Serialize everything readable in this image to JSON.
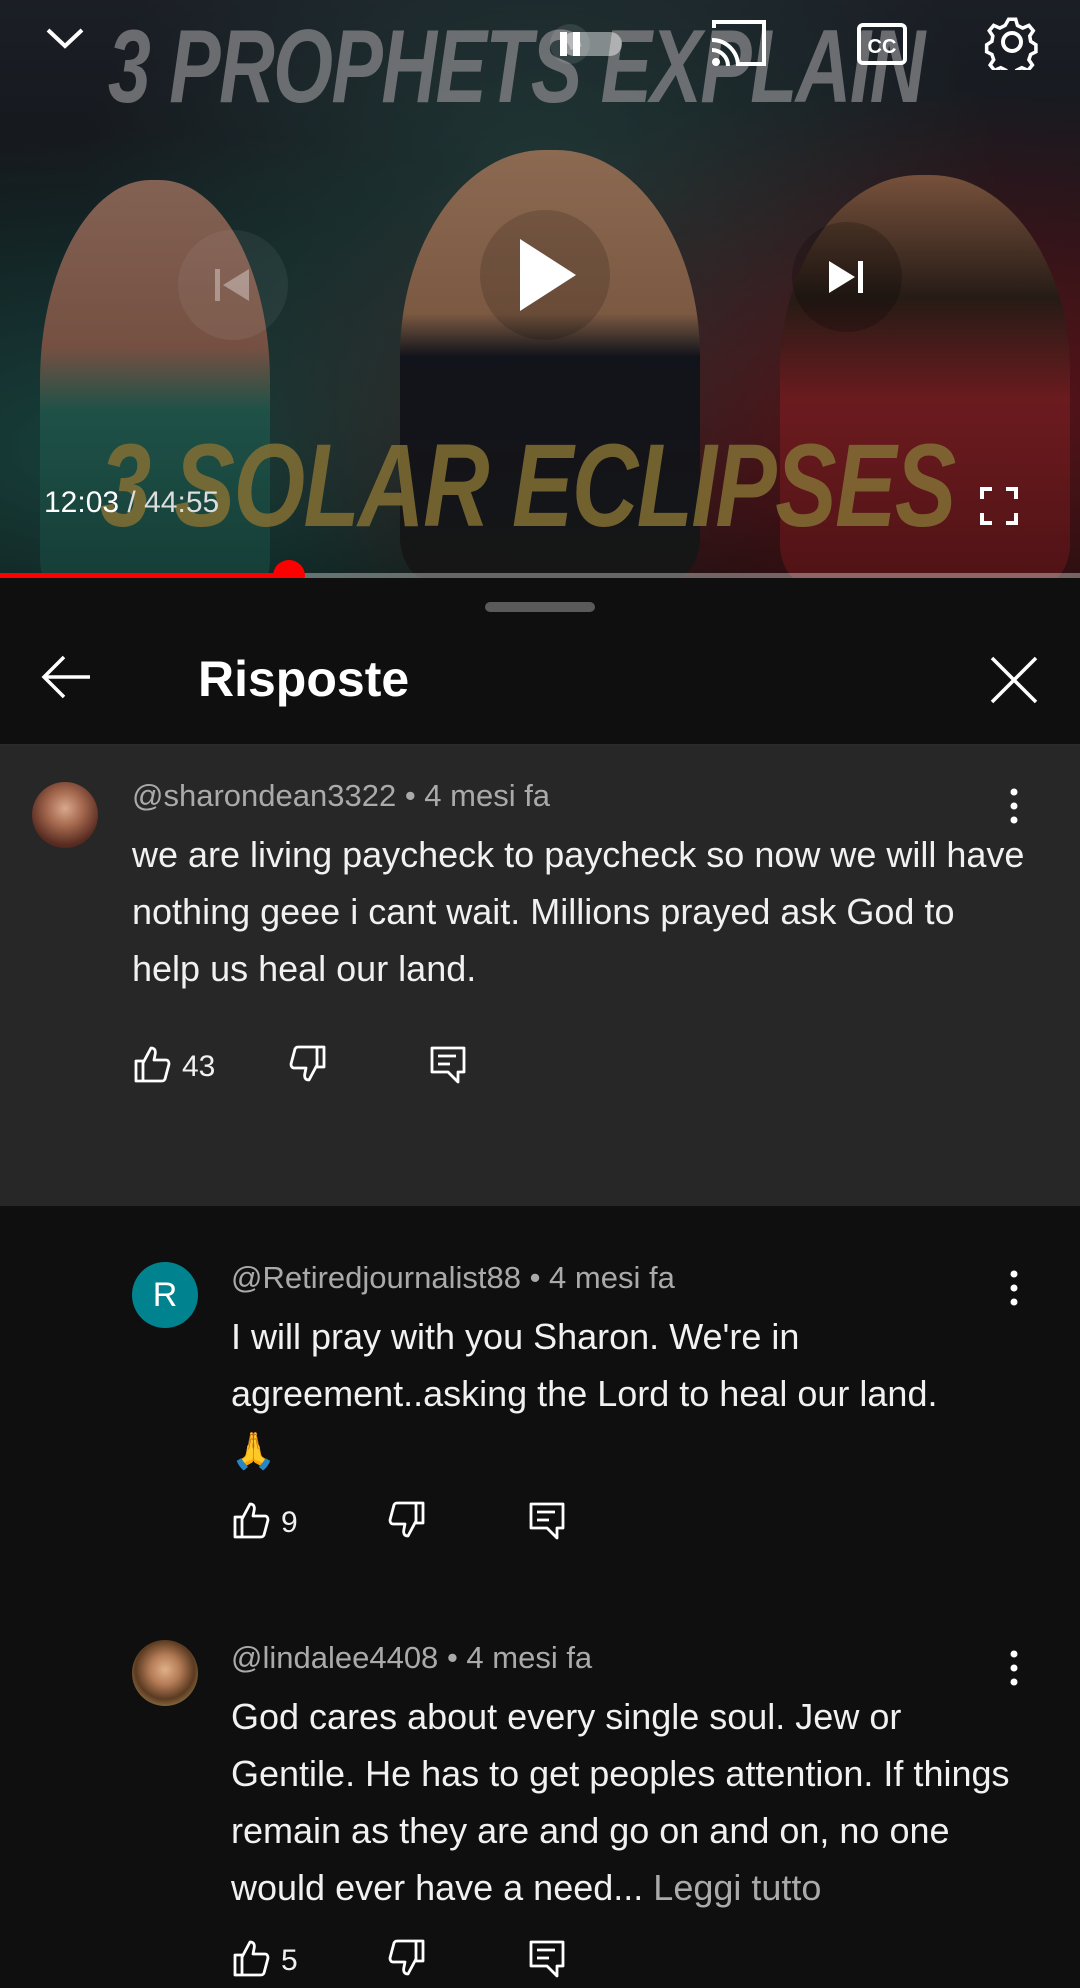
{
  "player": {
    "thumbnail_title_top": "3 PROPHETS EXPLAIN",
    "thumbnail_title_bottom": "3 SOLAR ECLIPSES",
    "current_time": "12:03",
    "separator": "/",
    "duration": "44:55",
    "progress_fraction": 0.268,
    "accent_color": "#ff0000"
  },
  "panel": {
    "title": "Risposte"
  },
  "comments": [
    {
      "author": "@sharondean3322",
      "time": "• 4 mesi fa",
      "avatar": "photo",
      "text": "we are living paycheck to paycheck so now we will have nothing geee i cant wait.  Millions prayed ask God to help us heal our land.",
      "likes": "43"
    },
    {
      "author": "@Retiredjournalist88",
      "time": "• 4 mesi fa",
      "avatar_letter": "R",
      "avatar_color": "#00838f",
      "text": "I will pray with you Sharon.  We're in agreement..asking the Lord to heal our land.",
      "emoji": "🙏",
      "likes": "9"
    },
    {
      "author": "@lindalee4408",
      "time": "• 4 mesi fa",
      "avatar": "photo",
      "text": "God cares about every single soul. Jew or Gentile. He has to get peoples attention. If things remain as they are and go on and on, no one would ever have a need...",
      "more_label": "Leggi tutto",
      "likes": "5"
    }
  ],
  "icons": {
    "collapse": "chevron-down-icon",
    "pause": "pause-icon",
    "cast": "cast-icon",
    "captions": "captions-icon",
    "settings": "gear-icon",
    "previous": "skip-previous-icon",
    "play": "play-icon",
    "next": "skip-next-icon",
    "fullscreen": "fullscreen-icon",
    "back": "arrow-left-icon",
    "close": "close-icon",
    "like": "thumbs-up-icon",
    "dislike": "thumbs-down-icon",
    "reply": "reply-icon",
    "more": "more-vertical-icon"
  }
}
